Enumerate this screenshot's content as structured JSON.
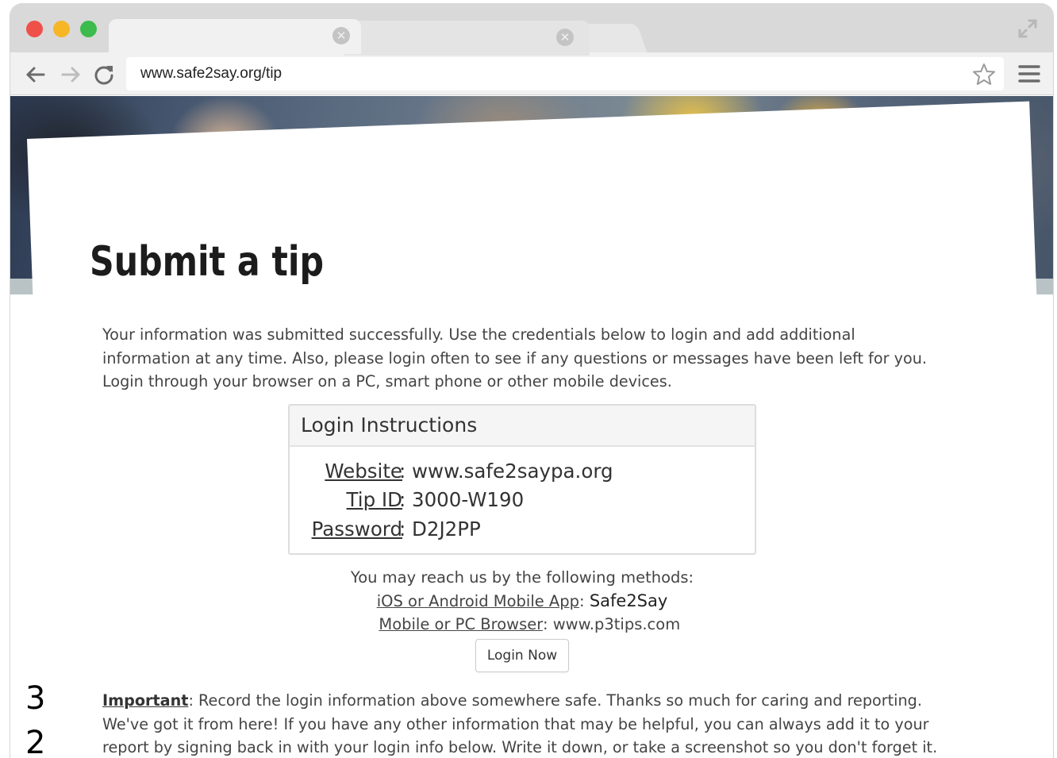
{
  "browser": {
    "url": "www.safe2say.org/tip",
    "tab_close_glyph": "✕"
  },
  "page": {
    "title": "Submit a tip",
    "intro": "Your information was submitted successfully. Use the credentials below to login and add additional information at any time. Also, please login often to see if any questions or messages have been left for you. Login through your browser on a PC, smart phone or other mobile devices.",
    "login_box": {
      "header": "Login Instructions",
      "rows": [
        {
          "label": "Website",
          "value": "www.safe2saypa.org"
        },
        {
          "label": "Tip ID",
          "value": "3000-W190"
        },
        {
          "label": "Password",
          "value": "D2J2PP"
        }
      ]
    },
    "reach": {
      "intro": "You may reach us by the following methods:",
      "app_label": "iOS or Android Mobile App",
      "app_value": "Safe2Say",
      "browser_label": "Mobile or PC Browser",
      "browser_value": "www.p3tips.com"
    },
    "login_button": "Login Now",
    "important": {
      "label": "Important",
      "text": "Record the login information above somewhere safe. Thanks so much for caring and reporting. We've got it from here! If you have any other information that may be helpful, you can always add it to your report by signing back in with your login info below. Write it down, or take a screenshot so you don't forget it."
    }
  },
  "page_number": "32",
  "colors": {
    "traffic_red": "#f0504a",
    "traffic_yellow": "#f6b626",
    "traffic_green": "#3dbb4c",
    "chrome_gray": "#d9d9d9",
    "toolbar_gray": "#f1f1f1",
    "text": "#444444"
  }
}
